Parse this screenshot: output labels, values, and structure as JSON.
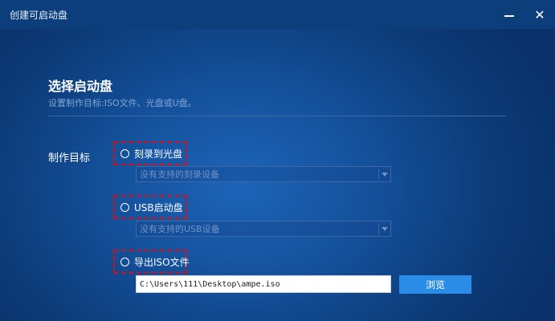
{
  "window": {
    "title": "创建可启动盘",
    "minimize_glyph": "—",
    "close_glyph": "✕"
  },
  "main": {
    "heading": "选择启动盘",
    "subheading": "设置制作目标:ISO文件、光盘或U盘。",
    "target_label": "制作目标"
  },
  "options": [
    {
      "label": "刻录到光盘",
      "selected": false
    },
    {
      "label": "USB启动盘",
      "selected": false
    },
    {
      "label": "导出ISO文件",
      "selected": false
    }
  ],
  "disc_select": {
    "value": "没有支持的刻录设备"
  },
  "usb_select": {
    "value": "没有支持的USB设备"
  },
  "iso": {
    "path": "C:\\Users\\111\\Desktop\\ampe.iso",
    "browse_label": "浏览"
  },
  "colors": {
    "background": "#14509a",
    "titlebar": "#0d3e7c",
    "highlight_border": "#d0111b",
    "button": "#2b8ce8"
  }
}
